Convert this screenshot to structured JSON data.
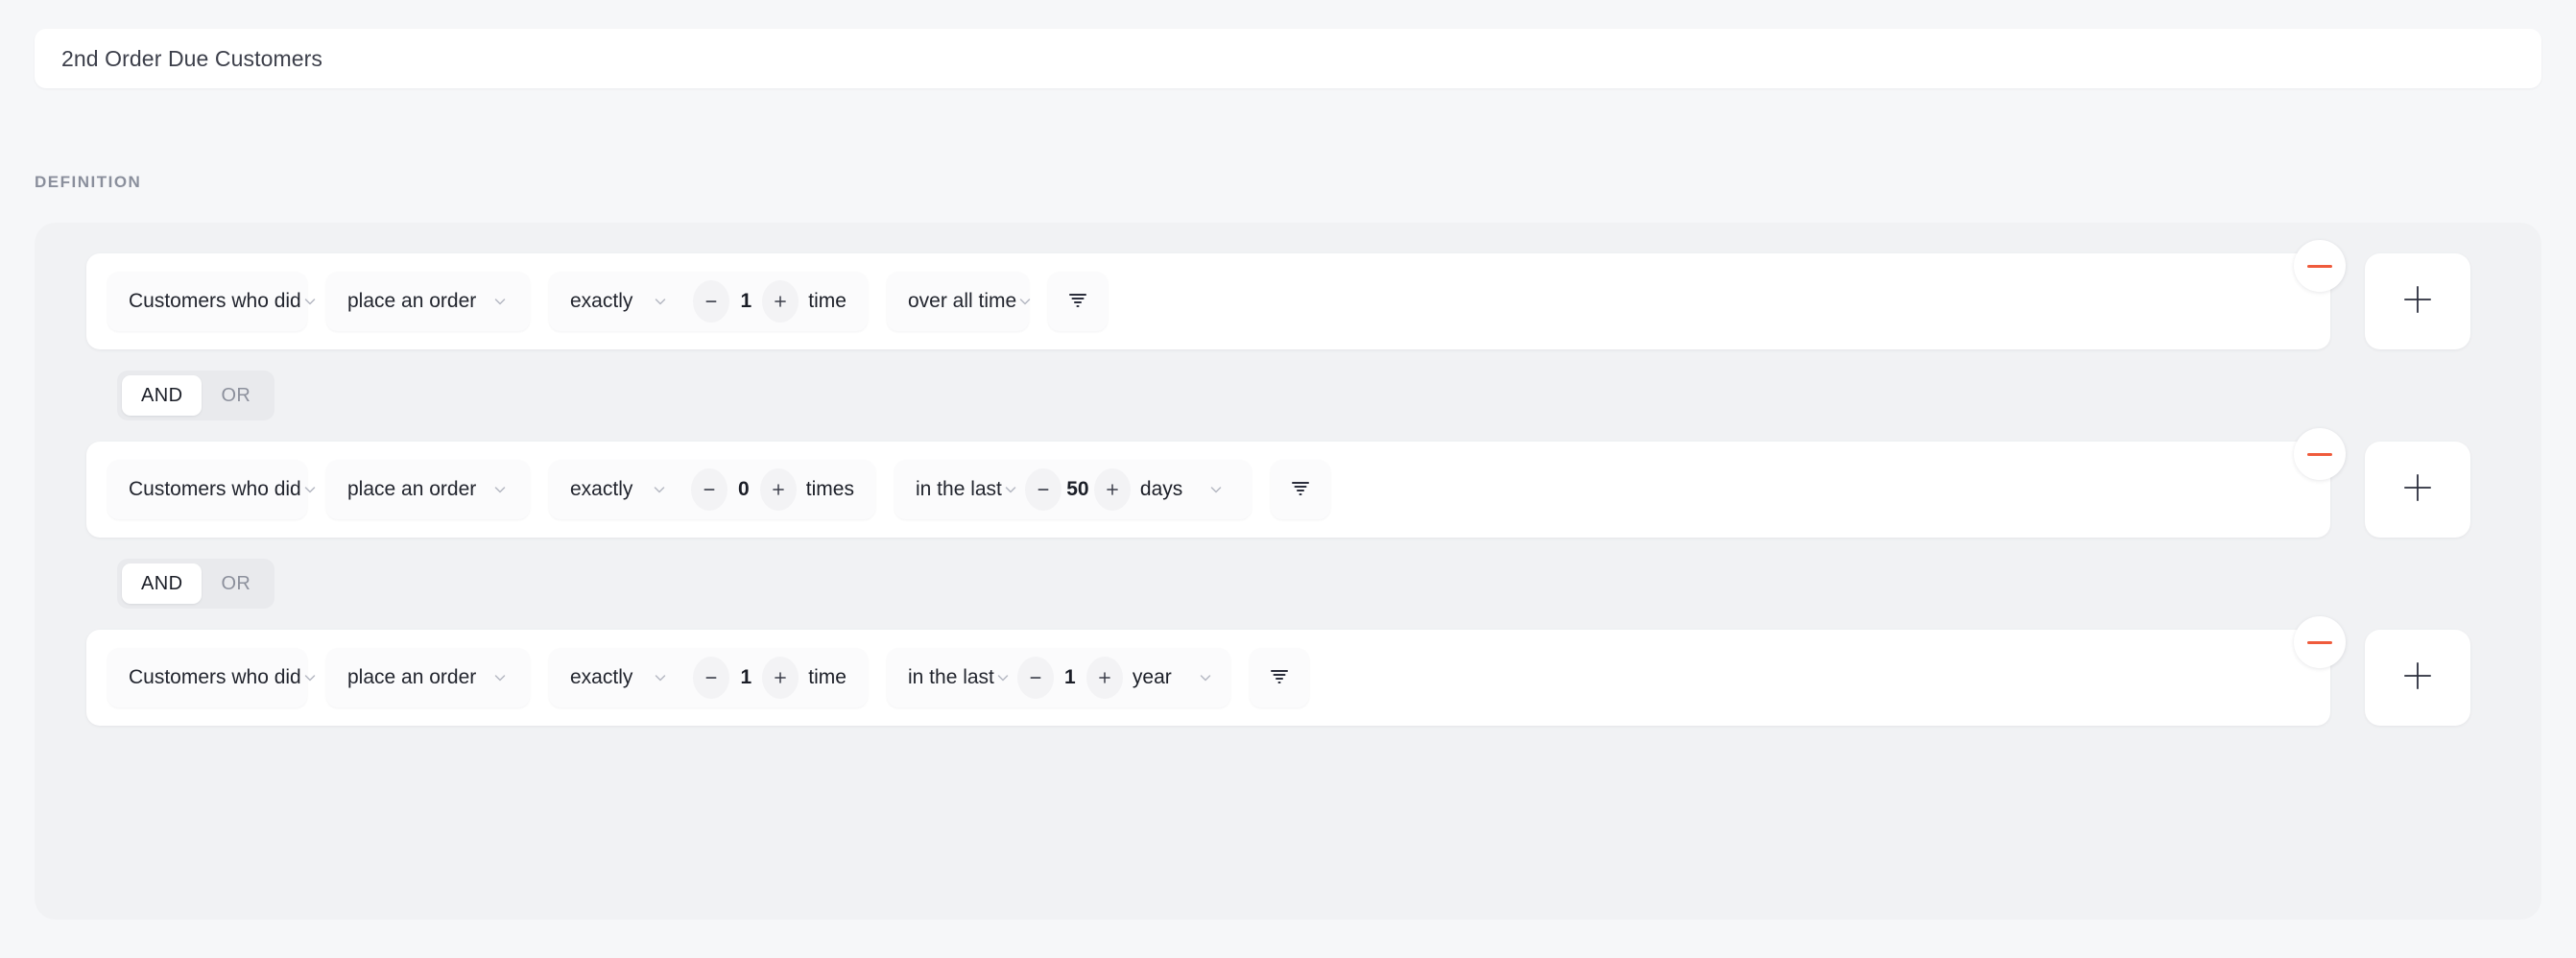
{
  "title_bar": {
    "value": "2nd Order Due Customers",
    "placeholder": "Segment name"
  },
  "section": {
    "label": "DEFINITION"
  },
  "connectors": {
    "and_label": "AND",
    "or_label": "OR",
    "selected_1": "AND",
    "selected_2": "AND"
  },
  "colors": {
    "remove_accent": "#ef5b3c",
    "page_bg": "#f6f7f9",
    "definition_bg": "#f1f2f4",
    "card_bg": "#ffffff",
    "text": "#1b1e27",
    "muted": "#8a8f9c"
  },
  "icons": {
    "chevron_down": "chevron-down-icon",
    "minus": "minus-icon",
    "plus": "plus-icon",
    "filter": "filter-icon"
  },
  "rows": [
    {
      "subject": "Customers who did",
      "event": "place an order",
      "frequency_operator": "exactly",
      "count_value": "1",
      "count_unit": "time",
      "time_range": "over all time",
      "time_has_stepper": false,
      "time_value": "",
      "time_unit": "",
      "filter_label": "filter-icon",
      "remove_label": "remove",
      "add_label": "+"
    },
    {
      "subject": "Customers who did",
      "event": "place an order",
      "frequency_operator": "exactly",
      "count_value": "0",
      "count_unit": "times",
      "time_range": "in the last",
      "time_has_stepper": true,
      "time_value": "50",
      "time_unit": "days",
      "filter_label": "filter-icon",
      "remove_label": "remove",
      "add_label": "+"
    },
    {
      "subject": "Customers who did",
      "event": "place an order",
      "frequency_operator": "exactly",
      "count_value": "1",
      "count_unit": "time",
      "time_range": "in the last",
      "time_has_stepper": true,
      "time_value": "1",
      "time_unit": "year",
      "filter_label": "filter-icon",
      "remove_label": "remove",
      "add_label": "+"
    }
  ]
}
